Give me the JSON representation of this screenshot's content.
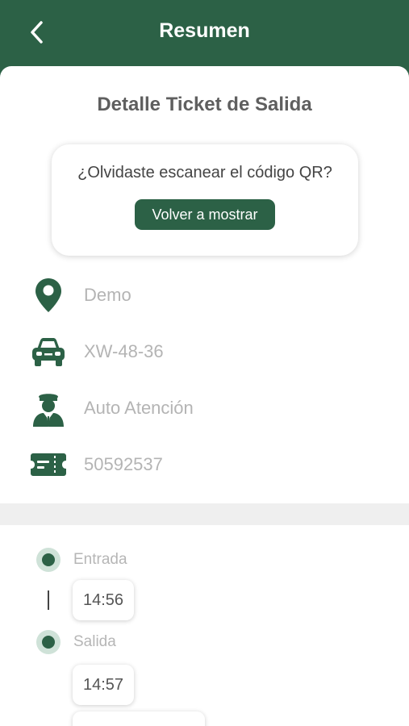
{
  "header": {
    "title": "Resumen",
    "back_icon": "chevron-left-icon"
  },
  "detail": {
    "title": "Detalle Ticket de Salida"
  },
  "qr_card": {
    "question": "¿Olvidaste escanear el código QR?",
    "button_label": "Volver a mostrar"
  },
  "info_rows": [
    {
      "icon": "location-pin-icon",
      "text": "Demo"
    },
    {
      "icon": "car-icon",
      "text": "XW-48-36"
    },
    {
      "icon": "attendant-icon",
      "text": "Auto Atención"
    },
    {
      "icon": "ticket-icon",
      "text": "50592537"
    }
  ],
  "timeline": {
    "entry": {
      "label": "Entrada",
      "time": "14:56"
    },
    "exit": {
      "label": "Salida",
      "time": "14:57"
    }
  },
  "colors": {
    "primary": "#2c6146",
    "primary_light": "#cfe2d8",
    "muted_text": "#b4b4b4"
  }
}
